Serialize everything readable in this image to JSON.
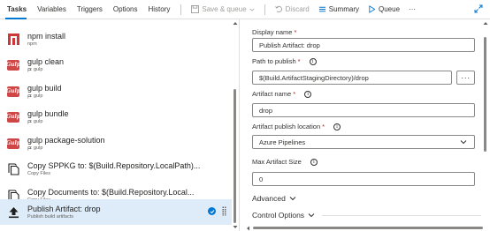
{
  "toolbar": {
    "tabs": [
      {
        "label": "Tasks",
        "active": true
      },
      {
        "label": "Variables",
        "active": false
      },
      {
        "label": "Triggers",
        "active": false
      },
      {
        "label": "Options",
        "active": false
      },
      {
        "label": "History",
        "active": false
      }
    ],
    "save_label": "Save & queue",
    "discard_label": "Discard",
    "summary_label": "Summary",
    "queue_label": "Queue",
    "more_label": "···",
    "accent_color": "#0078d4"
  },
  "tasks": [
    {
      "name": "npm install",
      "sub": "npm",
      "icon": "npm-icon",
      "sub_icon": false
    },
    {
      "name": "gulp clean",
      "sub": "gulp",
      "icon": "gulp-icon",
      "sub_icon": true
    },
    {
      "name": "gulp build",
      "sub": "gulp",
      "icon": "gulp-icon",
      "sub_icon": true
    },
    {
      "name": "gulp bundle",
      "sub": "gulp",
      "icon": "gulp-icon",
      "sub_icon": true
    },
    {
      "name": "gulp package-solution",
      "sub": "gulp",
      "icon": "gulp-icon",
      "sub_icon": true
    },
    {
      "name": "Copy SPPKG to: $(Build.Repository.LocalPath)...",
      "sub": "Copy Files",
      "icon": "copy-files-icon",
      "sub_icon": false
    },
    {
      "name": "Copy Documents to: $(Build.Repository.Local...",
      "sub": "Copy Files",
      "icon": "copy-files-icon",
      "sub_icon": false
    },
    {
      "name": "Publish Artifact: drop",
      "sub": "Publish build artifacts",
      "icon": "publish-icon",
      "sub_icon": false,
      "selected": true
    }
  ],
  "gulp_icon_text": "Gulp",
  "form": {
    "display_name": {
      "label": "Display name",
      "required": "*",
      "value": "Publish Artifact: drop"
    },
    "path_to_publish": {
      "label": "Path to publish",
      "required": "*",
      "value": "$(Build.ArtifactStagingDirectory)/drop",
      "more": "···"
    },
    "artifact_name": {
      "label": "Artifact name",
      "required": "*",
      "value": "drop"
    },
    "publish_location": {
      "label": "Artifact publish location",
      "required": "*",
      "value": "Azure Pipelines"
    },
    "max_size": {
      "label": "Max Artifact Size",
      "value": "0"
    },
    "advanced_label": "Advanced",
    "control_options_label": "Control Options",
    "info_glyph": "i"
  }
}
